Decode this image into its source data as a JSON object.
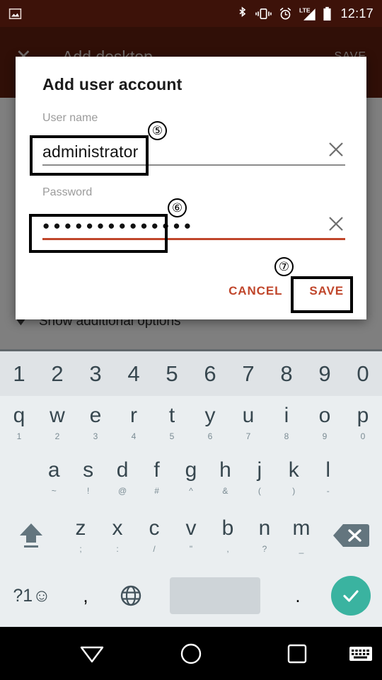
{
  "statusbar": {
    "time": "12:17",
    "icons": [
      "photo-icon",
      "bluetooth-icon",
      "vibrate-icon",
      "alarm-icon",
      "lte-signal-icon",
      "battery-icon"
    ],
    "network_label": "LTE",
    "background_color": "#3d1209"
  },
  "background_app": {
    "close_label": "✕",
    "title": "Add desktop",
    "save_label": "SAVE",
    "additional_options_label": "Show additional options",
    "toolbar_color": "#5d1e0f"
  },
  "dialog": {
    "title": "Add user account",
    "accent_color": "#c0462b",
    "fields": [
      {
        "label": "User name",
        "value": "administrator",
        "placeholder": "",
        "clear_icon": "close-icon",
        "focused": false
      },
      {
        "label": "Password",
        "value": "●●●●●●●●●●●●●●",
        "placeholder": "",
        "clear_icon": "close-icon",
        "focused": true
      }
    ],
    "cancel_label": "CANCEL",
    "save_label": "SAVE"
  },
  "annotations": [
    {
      "number": "⑤",
      "target": "username-field"
    },
    {
      "number": "⑥",
      "target": "password-field"
    },
    {
      "number": "⑦",
      "target": "save-button"
    }
  ],
  "keyboard": {
    "number_row": [
      "1",
      "2",
      "3",
      "4",
      "5",
      "6",
      "7",
      "8",
      "9",
      "0"
    ],
    "row1": [
      {
        "main": "q",
        "sub": "1"
      },
      {
        "main": "w",
        "sub": "2"
      },
      {
        "main": "e",
        "sub": "3"
      },
      {
        "main": "r",
        "sub": "4"
      },
      {
        "main": "t",
        "sub": "5"
      },
      {
        "main": "y",
        "sub": "6"
      },
      {
        "main": "u",
        "sub": "7"
      },
      {
        "main": "i",
        "sub": "8"
      },
      {
        "main": "o",
        "sub": "9"
      },
      {
        "main": "p",
        "sub": "0"
      }
    ],
    "row2": [
      {
        "main": "a",
        "sub": "~"
      },
      {
        "main": "s",
        "sub": "!"
      },
      {
        "main": "d",
        "sub": "@"
      },
      {
        "main": "f",
        "sub": "#"
      },
      {
        "main": "g",
        "sub": "^"
      },
      {
        "main": "h",
        "sub": "&"
      },
      {
        "main": "j",
        "sub": "("
      },
      {
        "main": "k",
        "sub": ")"
      },
      {
        "main": "l",
        "sub": "-"
      }
    ],
    "row3": [
      {
        "main": "z",
        "sub": ";"
      },
      {
        "main": "x",
        "sub": ":"
      },
      {
        "main": "c",
        "sub": "/"
      },
      {
        "main": "v",
        "sub": "\""
      },
      {
        "main": "b",
        "sub": ","
      },
      {
        "main": "n",
        "sub": "?"
      },
      {
        "main": "m",
        "sub": "_"
      }
    ],
    "shift_key": "shift-icon",
    "backspace_key": "backspace-icon",
    "symbols_key": "?1☺",
    "comma_key": ",",
    "globe_key": "globe-icon",
    "space_key": "",
    "period_key": ".",
    "enter_key": "check-icon",
    "enter_color": "#3ab3a0"
  },
  "navbar": {
    "back_label": "hide-keyboard-icon",
    "home_label": "home-icon",
    "recents_label": "recents-icon",
    "keyboard_label": "keyboard-switch-icon"
  }
}
